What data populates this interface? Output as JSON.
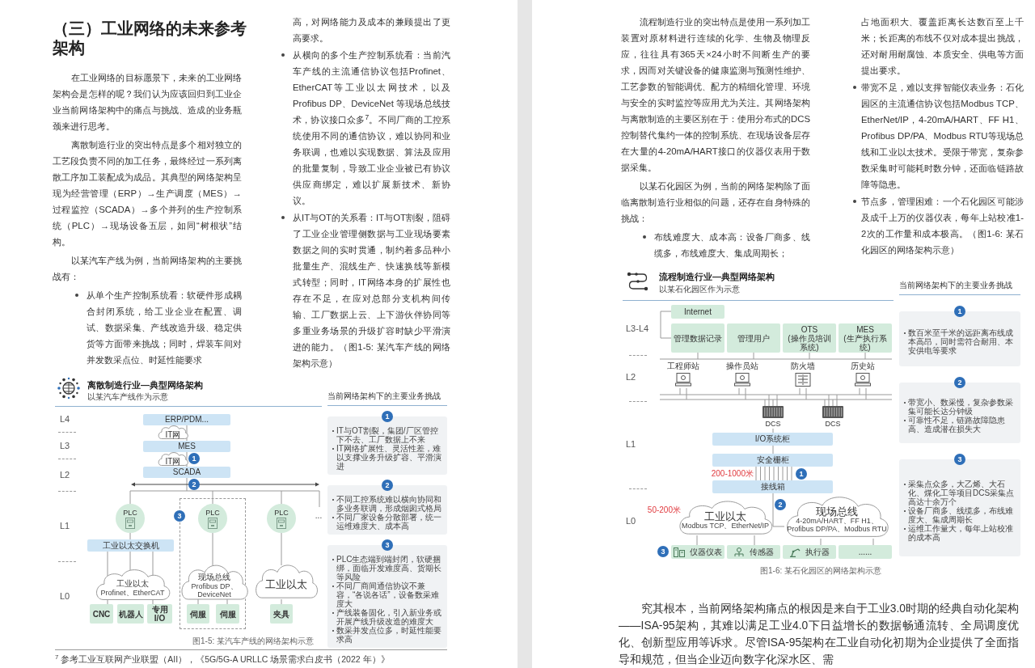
{
  "left_page": {
    "heading": "（三）工业网络的未来参考架构",
    "column_1": [
      {
        "kind": "paragraph",
        "text": "在工业网络的目标愿景下，未来的工业网络架构会是怎样的呢？我们认为应该回归到工业企业当前网络架构中的痛点与挑战、造成的业务瓶颈来进行思考。"
      },
      {
        "kind": "paragraph",
        "text": "离散制造行业的突出特点是多个相对独立的工艺段负责不同的加工任务，最终经过一系列离散工序加工装配成为成品。其典型的网络架构呈现为经营管理（ERP）→生产调度（MES）→过程监控（SCADA）→多个并列的生产控制系统（PLC）→现场设备五层，如同“树根状”结构。"
      },
      {
        "kind": "paragraph",
        "text": "以某汽车产线为例，当前网络架构的主要挑战有："
      },
      {
        "kind": "bullet",
        "text": "从单个生产控制系统看：软硬件形成耦合封闭系统，给工业企业在配置、调试、数据采集、产线改造升级、稳定供货等方面带来挑战；同时，焊装车间对并发数采点位、时延性能要求"
      }
    ],
    "column_2": [
      {
        "kind": "continuation",
        "text": "高，对网络能力及成本的兼顾提出了更高要求。"
      },
      {
        "kind": "bullet",
        "text": "从横向的多个生产控制系统看：当前汽车产线的主流通信协议包括Profinet、EtherCAT等工业以太网技术，以及Profibus DP、DeviceNet 等现场总线技术，协议接口众多$^{7}$。不同厂商的工控系统使用不同的通信协议，难以协同和业务联调，也难以实现数据、算法及应用的批量复制，导致工业企业被已有协议供应商绑定，难以扩展新技术、新协议。"
      },
      {
        "kind": "bullet",
        "text": "从IT与OT的关系看：IT与OT割裂，阻碍了工业企业管理侧数据与工业现场要素数据之间的实时贯通，制约着多品种小批量生产、混线生产、快速换线等新模式转型；同时，IT网络本身的扩展性也存在不足，在应对总部分支机构间传输、工厂数据上云、上下游伙伴协同等多重业务场景的升级扩容时缺少平滑演进的能力。（图1-5: 某汽车产线的网络架构示意）"
      }
    ],
    "figure": {
      "title": "离散制造行业—典型网络架构",
      "subtitle": "以某汽车产线作为示意",
      "levels": [
        "L4",
        "L3",
        "L2",
        "L1",
        "L0"
      ],
      "nodes": [
        {
          "kind": "bar",
          "text": "ERP/PDM..."
        },
        {
          "kind": "cloud",
          "text": "IT网"
        },
        {
          "kind": "bar",
          "text": "MES"
        },
        {
          "kind": "cloud",
          "text": "IT网"
        },
        {
          "kind": "bar",
          "text": "SCADA"
        },
        {
          "kind": "plc",
          "text": "PLC"
        },
        {
          "kind": "plc",
          "text": "PLC"
        },
        {
          "kind": "plc",
          "text": "PLC"
        },
        {
          "kind": "more",
          "text": "..."
        },
        {
          "kind": "bar",
          "text": "工业以太交换机"
        },
        {
          "kind": "cloud",
          "text": "工业以太",
          "sub": "Profinet、EtherCAT"
        },
        {
          "kind": "cloud",
          "text": "现场总线",
          "sub": "Profibus DP、DeviceNet"
        },
        {
          "kind": "cloud",
          "text": "工业以太"
        },
        {
          "kind": "leaf",
          "text": "CNC"
        },
        {
          "kind": "leaf",
          "text": "机器人"
        },
        {
          "kind": "leaf",
          "text": "专用 I/O"
        },
        {
          "kind": "leaf",
          "text": "伺服"
        },
        {
          "kind": "leaf",
          "text": "伺服"
        },
        {
          "kind": "leaf",
          "text": "夹具"
        }
      ],
      "badges": [
        "1",
        "2",
        "3"
      ],
      "challenges_title": "当前网络架构下的主要业务挑战",
      "challenges": [
        {
          "number": "1",
          "points": [
            "IT与OT割裂，集团/厂区管控下不去、工厂数据上不来",
            "IT网络扩展性、灵活性差，难以支撑业务升级扩容、平滑演进"
          ]
        },
        {
          "number": "2",
          "points": [
            "不同工控系统难以横向协同和多业务联调，形成烟囱式格局",
            "不同厂家设备分散部署，统一运维难度大、成本高"
          ]
        },
        {
          "number": "3",
          "points": [
            "PLC生态端到端封闭，软硬捆绑，面临开发难度高、货期长等风险",
            "不同厂商间通信协议不兼容，“各说各话”，设备数采难度大",
            "产线装备固化，引入新业务或开展产线升级改造的难度大",
            "数采并发点位多，时延性能要求高"
          ]
        }
      ],
      "caption": "图1-5: 某汽车产线的网络架构示意"
    },
    "footnote": "$^{7}$ 参考工业互联网产业联盟（AII），《5G/5G-A URLLC 场景需求白皮书（2022 年）》"
  },
  "right_page": {
    "column_1": [
      {
        "kind": "paragraph",
        "text": "流程制造行业的突出特点是使用一系列加工装置对原材料进行连续的化学、生物及物理反应，往往具有365天×24小时不间断生产的要求，因而对关键设备的健康监测与预测性维护、工艺参数的智能调优、配方的精细化管理、环境与安全的实时监控等应用尤为关注。其网络架构与离散制造的主要区别在于：使用分布式的DCS控制替代集约一体的控制系统、在现场设备层存在大量的4-20mA/HART接口的仪器仪表用于数据采集。"
      },
      {
        "kind": "paragraph",
        "text": "以某石化园区为例，当前的网络架构除了面临离散制造行业相似的问题，还存在自身特殊的挑战："
      },
      {
        "kind": "bullet",
        "text": "布线难度大、成本高：设备厂商多、线缆多，布线难度大、集成周期长；"
      }
    ],
    "column_2": [
      {
        "kind": "continuation",
        "text": "占地面积大、覆盖距离长达数百至上千米；长距离的布线不仅对成本提出挑战，还对耐用耐腐蚀、本质安全、供电等方面提出要求。"
      },
      {
        "kind": "bullet",
        "text": "带宽不足，难以支撑智能仪表业务：石化园区的主流通信协议包括Modbus TCP、EtherNet/IP，4-20mA/HART、FF H1、Profibus DP/PA、Modbus RTU等现场总线和工业以太技术。受限于带宽，复杂参数采集时可能耗时数分钟，还面临链路故障等隐患。"
      },
      {
        "kind": "bullet",
        "text": "节点多，管理困难：一个石化园区可能涉及成千上万的仪器仪表，每年上站校准1-2次的工作量和成本极高。（图1-6: 某石化园区的网络架构示意）"
      }
    ],
    "figure": {
      "title": "流程制造行业—典型网络架构",
      "subtitle": "以某石化园区作为示意",
      "levels": [
        "L3-L4",
        "L2",
        "L1",
        "L0"
      ],
      "nodes": [
        {
          "kind": "green",
          "text": "Internet"
        },
        {
          "kind": "green",
          "text": "管理数据记录"
        },
        {
          "kind": "green",
          "text": "管理用户"
        },
        {
          "kind": "green",
          "text": "OTS",
          "sub": "(操作员培训系统)"
        },
        {
          "kind": "green",
          "text": "MES",
          "sub": "(生产执行系统)"
        },
        {
          "kind": "station",
          "text": "工程师站"
        },
        {
          "kind": "station",
          "text": "操作员站"
        },
        {
          "kind": "station",
          "text": "防火墙"
        },
        {
          "kind": "station",
          "text": "历史站"
        },
        {
          "kind": "dcs",
          "text": "DCS"
        },
        {
          "kind": "dcs",
          "text": "DCS"
        },
        {
          "kind": "bar",
          "text": "I/O系统柜"
        },
        {
          "kind": "bar",
          "text": "安全栅柜"
        },
        {
          "kind": "bar",
          "text": "接线箱"
        },
        {
          "kind": "distance",
          "text": "200-1000米"
        },
        {
          "kind": "distance",
          "text": "50-200米"
        },
        {
          "kind": "cloud",
          "text": "工业以太",
          "sub": "Modbus TCP、EtherNet/IP"
        },
        {
          "kind": "cloud",
          "text": "现场总线",
          "sub": "4-20mA/HART、FF H1、Profibus DP/PA、Modbus RTU"
        },
        {
          "kind": "device",
          "text": "仪器仪表"
        },
        {
          "kind": "device",
          "text": "传感器"
        },
        {
          "kind": "device",
          "text": "执行器"
        },
        {
          "kind": "device",
          "text": "......"
        }
      ],
      "badges": [
        "1",
        "2",
        "3"
      ],
      "challenges_title": "当前网络架构下的主要业务挑战",
      "challenges": [
        {
          "number": "1",
          "points": [
            "数百米至千米的远距离布线成本高昂，同时需符合耐用、本安供电等要求"
          ]
        },
        {
          "number": "2",
          "points": [
            "带宽小、数采慢，复杂参数采集可能长达分钟级",
            "可靠性不足，链路故障隐患高、造成潜在损失大"
          ]
        },
        {
          "number": "3",
          "points": [
            "采集点众多，大乙烯、大石化、煤化工等项目DCS采集点高达十余万个",
            "设备厂商多、线缆多，布线难度大、集成周期长",
            "运维工作量大，每年上站校准的成本高"
          ]
        }
      ],
      "caption": "图1-6: 某石化园区的网络架构示意"
    },
    "closing_paragraph": "究其根本，当前网络架构痛点的根因是来自于工业3.0时期的经典自动化架构——ISA-95架构，其难以满足工业4.0下日益增长的数据畅通流转、全局调度优化、创新型应用等诉求。尽管ISA-95架构在工业自动化初期为企业提供了全面指导和规范，但当企业迈向数字化深水区、需"
  }
}
